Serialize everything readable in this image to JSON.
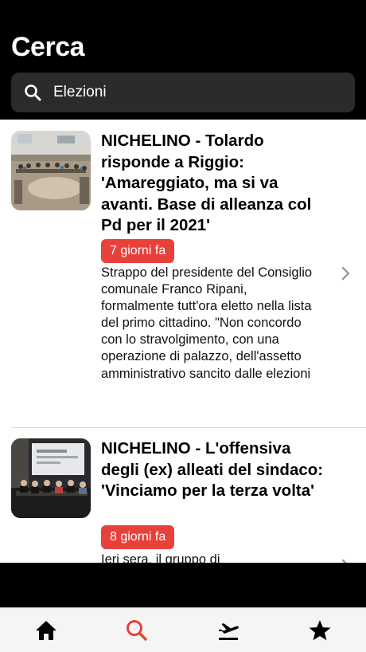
{
  "header": {
    "title": "Cerca"
  },
  "search": {
    "value": "Elezioni",
    "icon": "search-icon"
  },
  "articles": [
    {
      "headline": "NICHELINO - Tolardo risponde a Riggio: 'Amareggiato, ma si va avanti. Base di alleanza col Pd per il 2021'",
      "badge": "7 giorni fa",
      "excerpt": "Strappo del presidente del Consiglio comunale Franco Ripani, formalmente tutt'ora eletto nella lista del primo cittadino. \"Non concordo con lo stravolgimento, con una operazione di palazzo, dell'assetto amministrativo sancito dalle elezioni"
    },
    {
      "headline": "NICHELINO - L'offensiva degli (ex) alleati del sindaco: 'Vinciamo per la terza volta'",
      "badge": "8 giorni fa",
      "excerpt": "Ieri sera, il gruppo di"
    }
  ],
  "tabs": [
    {
      "name": "home",
      "icon": "home-icon",
      "active": false
    },
    {
      "name": "search",
      "icon": "search-icon",
      "active": true
    },
    {
      "name": "departures",
      "icon": "plane-departure-icon",
      "active": false
    },
    {
      "name": "favorites",
      "icon": "star-icon",
      "active": false
    }
  ],
  "colors": {
    "accent": "#e8413b",
    "header_bg": "#000000",
    "search_bg": "#2b2b2d",
    "tab_inactive": "#000000"
  }
}
